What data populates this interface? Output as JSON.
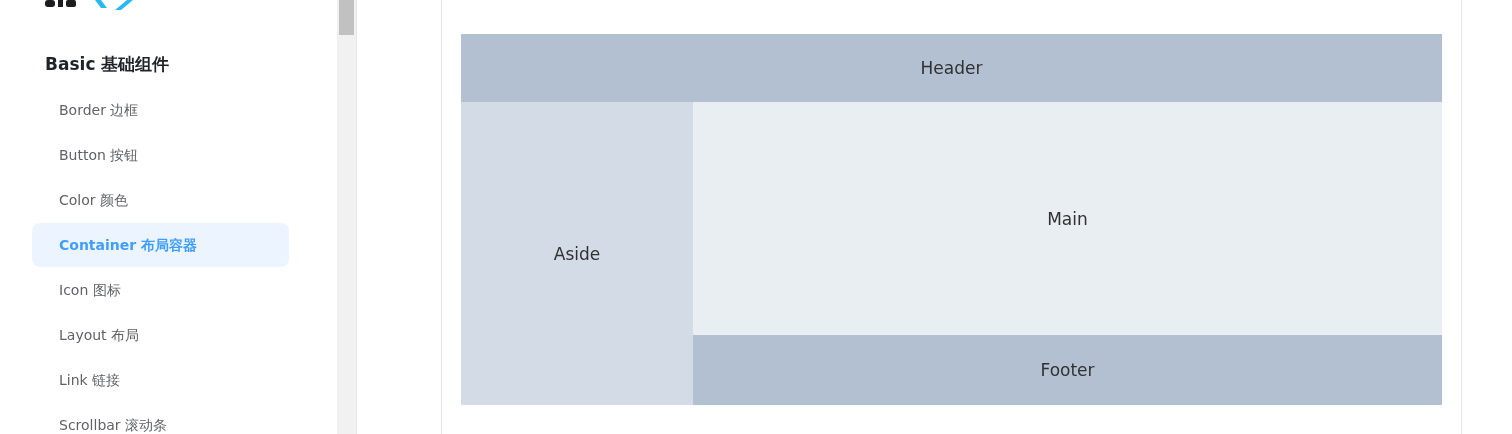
{
  "sidebar": {
    "group_title": "Basic 基础组件",
    "items": [
      {
        "label": "Border 边框",
        "selected": false
      },
      {
        "label": "Button 按钮",
        "selected": false
      },
      {
        "label": "Color 颜色",
        "selected": false
      },
      {
        "label": "Container 布局容器",
        "selected": true
      },
      {
        "label": "Icon 图标",
        "selected": false
      },
      {
        "label": "Layout 布局",
        "selected": false
      },
      {
        "label": "Link 链接",
        "selected": false
      },
      {
        "label": "Scrollbar 滚动条",
        "selected": false
      }
    ]
  },
  "demo": {
    "header": "Header",
    "aside": "Aside",
    "main": "Main",
    "footer": "Footer"
  }
}
